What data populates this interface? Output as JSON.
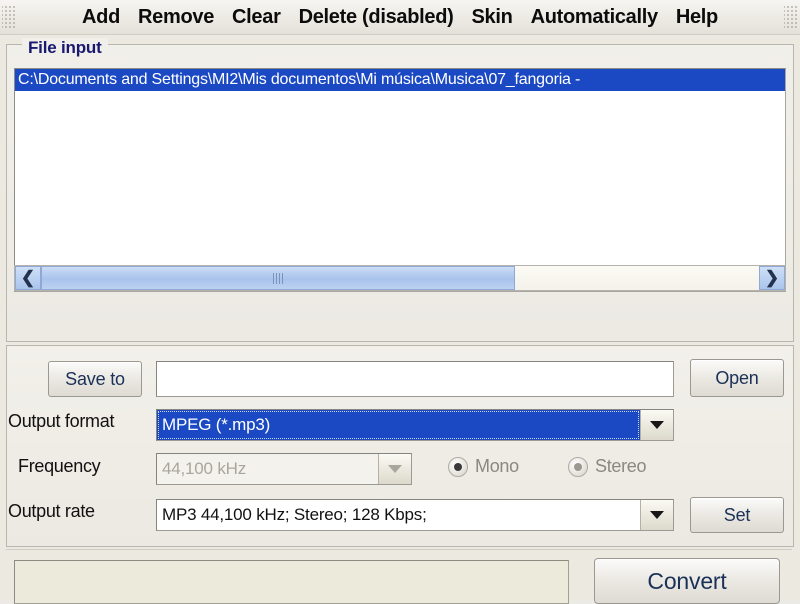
{
  "menubar": {
    "grip_left_icon": "drag-grip-icon",
    "grip_right_icon": "drag-grip-icon",
    "items": [
      {
        "label": "Add",
        "name": "menu-add"
      },
      {
        "label": "Remove",
        "name": "menu-remove"
      },
      {
        "label": "Clear",
        "name": "menu-clear"
      },
      {
        "label": "Delete (disabled)",
        "name": "menu-delete"
      },
      {
        "label": "Skin",
        "name": "menu-skin"
      },
      {
        "label": "Automatically",
        "name": "menu-automatically"
      },
      {
        "label": "Help",
        "name": "menu-help"
      }
    ]
  },
  "file_input": {
    "group_title": "File input",
    "rows": [
      {
        "path": "C:\\Documents and Settings\\MI2\\Mis documentos\\Mi música\\Musica\\07_fangoria  -",
        "selected": true
      }
    ],
    "scrollbar": {
      "left_arrow": "❮",
      "right_arrow": "❯",
      "thumb_grip_icon": "scroll-thumb-grip-icon"
    }
  },
  "settings": {
    "save_to_label": "Save to",
    "save_to_value": "",
    "save_to_placeholder": "",
    "open_label": "Open",
    "output_format_label": "Output format",
    "output_format_value": "MPEG (*.mp3)",
    "frequency_label": "Frequency",
    "frequency_value": "44,100 kHz",
    "channel_mono_label": "Mono",
    "channel_stereo_label": "Stereo",
    "channel_selected": "Mono",
    "output_rate_label": "Output rate",
    "output_rate_value": "MP3 44,100 kHz; Stereo;  128 Kbps;",
    "set_label": "Set"
  },
  "footer": {
    "status_text": "",
    "convert_label": "Convert"
  },
  "colors": {
    "selection_blue": "#1b49c4",
    "group_title_navy": "#191970",
    "button_text_navy": "#1c3158",
    "status_panel_bg": "#eceadb",
    "face": "#ece9e1"
  }
}
